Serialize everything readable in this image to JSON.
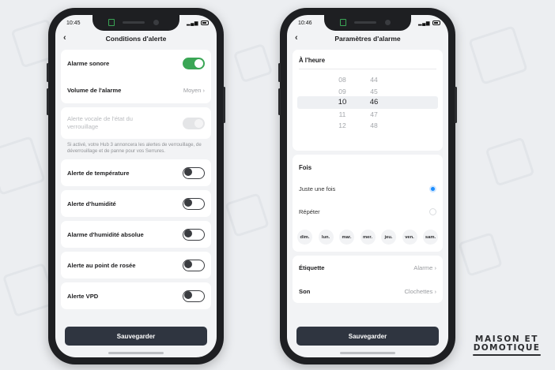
{
  "left_phone": {
    "status_time": "10:45",
    "status_right": "⁵ᴳ ☰ 74",
    "title": "Conditions d'alerte",
    "rows": [
      {
        "label": "Alarme sonore",
        "toggle": "on"
      },
      {
        "label": "Volume de l'alarme",
        "value": "Moyen"
      },
      {
        "label": "Alerte vocale de l'état du verrouillage",
        "toggle": "disabled"
      },
      {
        "label": "Alerte de température",
        "toggle": "off"
      },
      {
        "label": "Alerte d'humidité",
        "toggle": "off"
      },
      {
        "label": "Alarme d'humidité absolue",
        "toggle": "off"
      },
      {
        "label": "Alerte au point de rosée",
        "toggle": "off"
      },
      {
        "label": "Alerte VPD",
        "toggle": "off"
      }
    ],
    "note": "Si activé, votre Hub 3 annoncera les alertes de verrouillage, de déverrouillage et de panne pour vos Serrures.",
    "save": "Sauvegarder"
  },
  "right_phone": {
    "status_time": "10:46",
    "status_right": "⁵ᴳ ☰ 74",
    "title": "Paramètres d'alarme",
    "time_section": "À l'heure",
    "hours": [
      "08",
      "09",
      "10",
      "11",
      "12"
    ],
    "minutes": [
      "44",
      "45",
      "46",
      "47",
      "48"
    ],
    "selected_hour": "10",
    "selected_minute": "46",
    "repeat_section": "Fois",
    "options": [
      {
        "label": "Juste une fois",
        "selected": true
      },
      {
        "label": "Répéter",
        "selected": false
      }
    ],
    "days": [
      "dim.",
      "lun.",
      "mar.",
      "mer.",
      "jeu.",
      "ven.",
      "sam."
    ],
    "label_row": {
      "label": "Étiquette",
      "value": "Alarme"
    },
    "sound_row": {
      "label": "Son",
      "value": "Clochettes"
    },
    "save": "Sauvegarder"
  },
  "logo": {
    "line1": "MAISON ET",
    "line2": "DOMOTIQUE"
  },
  "colors": {
    "accent_green": "#3aa655",
    "radio_blue": "#1a8cff",
    "button_dark": "#2f3540"
  }
}
